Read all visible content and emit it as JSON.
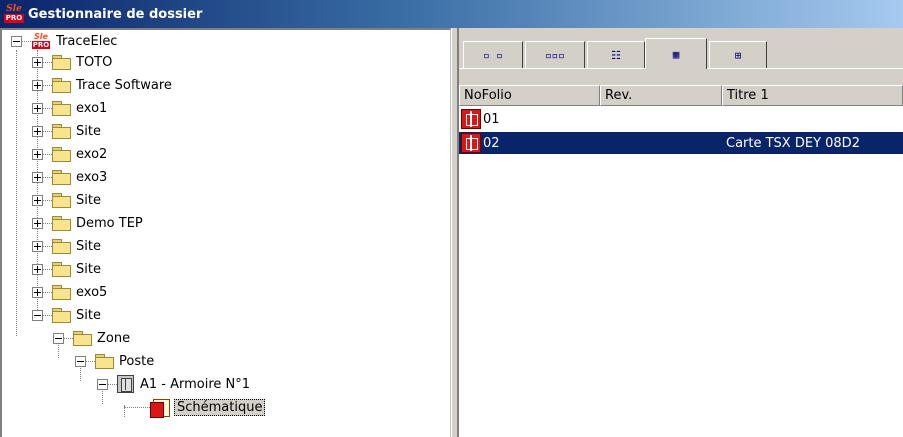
{
  "window": {
    "title": "Gestionnaire de dossier",
    "app_icon_top": "Sle",
    "app_icon_badge": "PRO"
  },
  "tree": {
    "root": {
      "label": "TraceElec",
      "icon_top": "Sle",
      "icon_badge": "PRO"
    },
    "folders": [
      {
        "label": "TOTO"
      },
      {
        "label": "Trace Software"
      },
      {
        "label": "exo1"
      },
      {
        "label": "Site"
      },
      {
        "label": "exo2"
      },
      {
        "label": "exo3"
      },
      {
        "label": "Site"
      },
      {
        "label": "Demo TEP"
      },
      {
        "label": "Site"
      },
      {
        "label": "Site"
      },
      {
        "label": "exo5"
      },
      {
        "label": "Site"
      }
    ],
    "zone": {
      "label": "Zone"
    },
    "poste": {
      "label": "Poste"
    },
    "armoire": {
      "label": "A1 - Armoire N°1"
    },
    "schematique": {
      "label": "Schématique"
    }
  },
  "view_tabs": [
    {
      "name": "large-icons",
      "glyph": "▫ ▫"
    },
    {
      "name": "small-icons",
      "glyph": "▫▫▫"
    },
    {
      "name": "list",
      "glyph": "☷"
    },
    {
      "name": "details",
      "glyph": "▦"
    },
    {
      "name": "thumbnails",
      "glyph": "⊞"
    }
  ],
  "list": {
    "columns": [
      "NoFolio",
      "Rev.",
      "Titre 1"
    ],
    "rows": [
      {
        "folio": "01",
        "rev": "",
        "titre": ""
      },
      {
        "folio": "02",
        "rev": "",
        "titre": "Carte TSX DEY 08D2"
      }
    ]
  },
  "colors": {
    "title_bar_start": "#0a246a",
    "title_bar_end": "#a6caf0",
    "selection": "#0a246a",
    "icon_red": "#d81818",
    "folder_yellow": "#f8e48c"
  }
}
